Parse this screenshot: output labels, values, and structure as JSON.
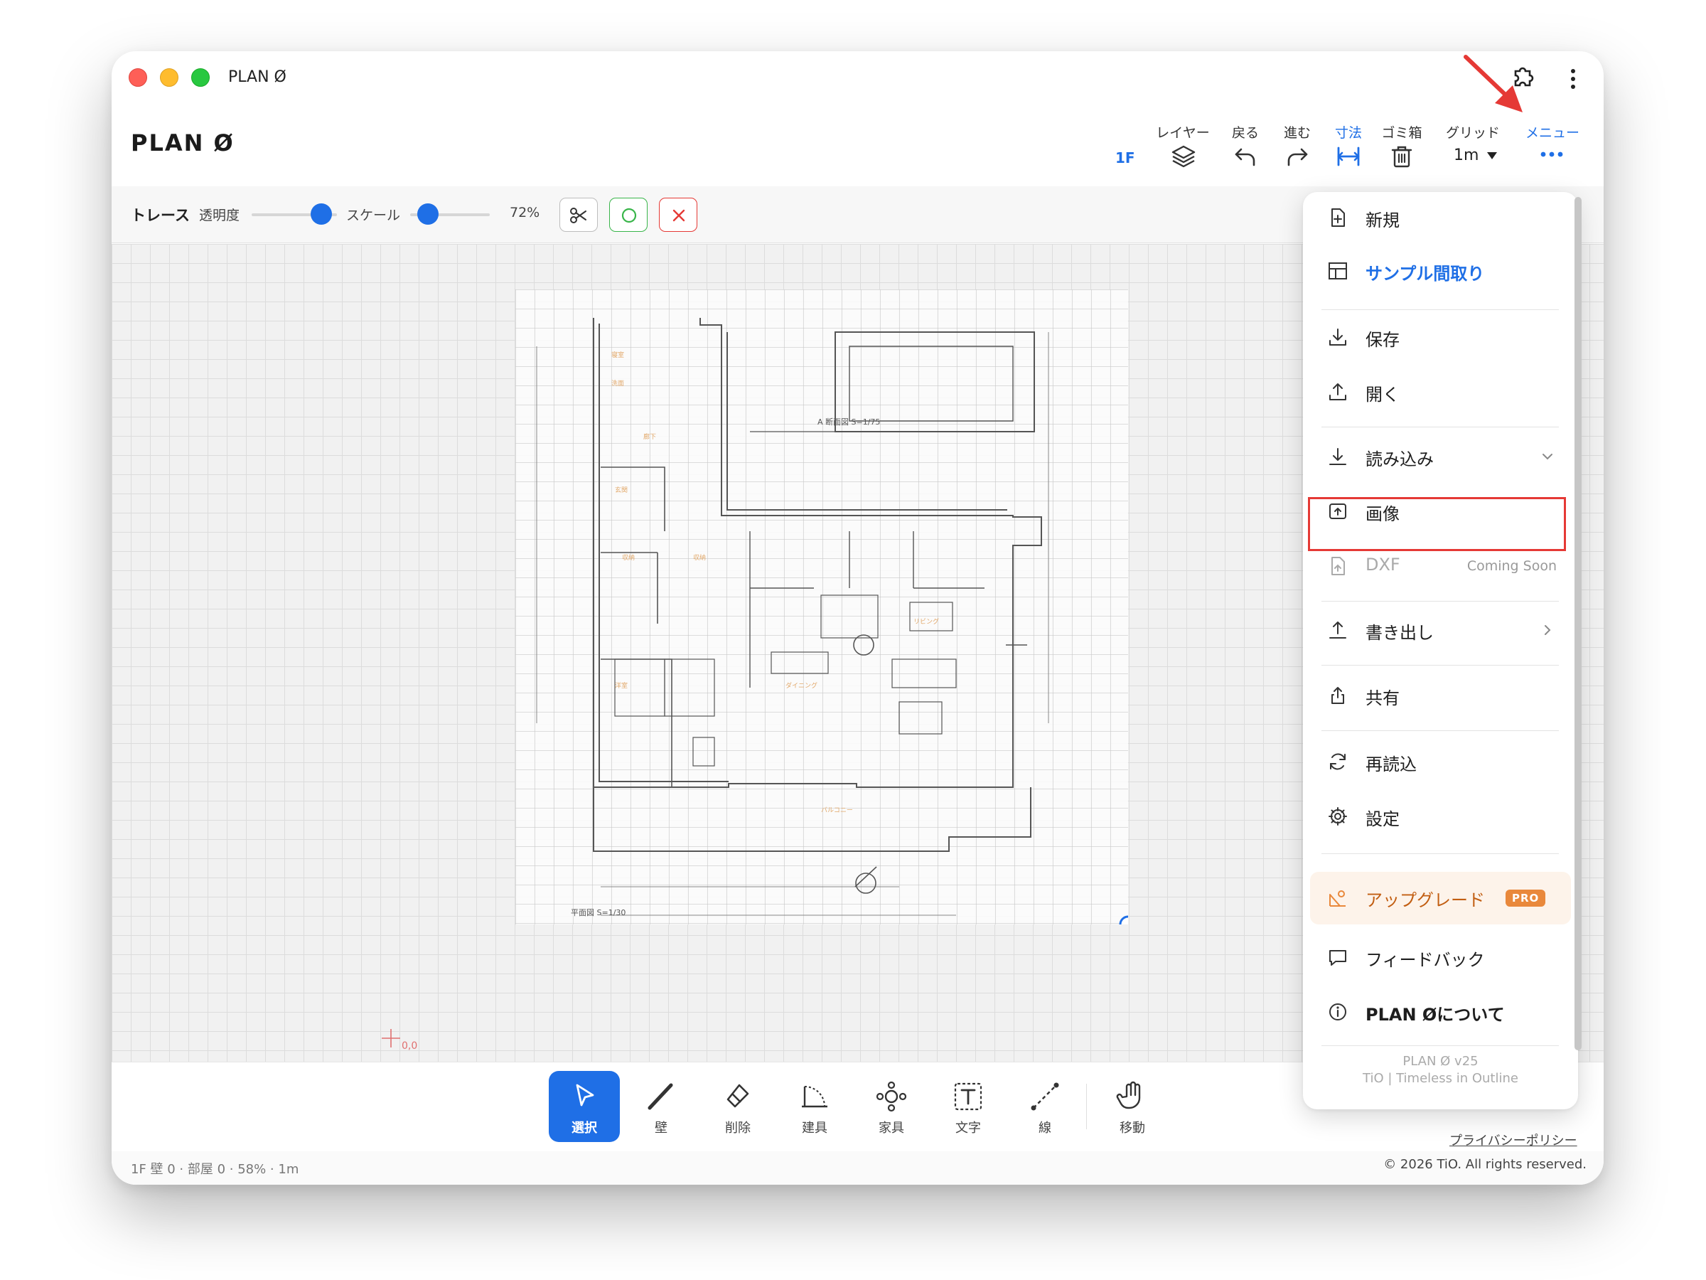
{
  "window": {
    "title": "PLAN Ø"
  },
  "header": {
    "app_title": "PLAN Ø",
    "floor": "1F",
    "tools": [
      {
        "label": "レイヤー",
        "icon": "layers-icon"
      },
      {
        "label": "戻る",
        "icon": "undo-icon"
      },
      {
        "label": "進む",
        "icon": "redo-icon"
      },
      {
        "label": "寸法",
        "icon": "dimension-icon",
        "active": true
      },
      {
        "label": "ゴミ箱",
        "icon": "trash-icon"
      },
      {
        "label": "グリッド",
        "icon": "grid-select"
      },
      {
        "label": "メニュー",
        "icon": "more-icon",
        "active": true
      }
    ],
    "grid_value": "1m"
  },
  "trace": {
    "title": "トレース",
    "opacity_label": "透明度",
    "opacity_value": 0.8,
    "scale_label": "スケール",
    "scale_value": 0.25,
    "scale_percent": "72%"
  },
  "canvas": {
    "origin_label": "0,0",
    "plan_caption": "平面図 S=1/30",
    "section_caption": "A 断面図 S=1/75"
  },
  "bottom_tools": [
    {
      "label": "選択",
      "icon": "select-cursor-icon",
      "active": true
    },
    {
      "label": "壁",
      "icon": "wall-pen-icon"
    },
    {
      "label": "削除",
      "icon": "eraser-icon"
    },
    {
      "label": "建具",
      "icon": "door-icon"
    },
    {
      "label": "家具",
      "icon": "furniture-icon"
    },
    {
      "label": "文字",
      "icon": "text-icon"
    },
    {
      "label": "線",
      "icon": "line-icon"
    },
    {
      "label": "移動",
      "icon": "hand-icon"
    }
  ],
  "footer": {
    "status": "1F 壁 0 · 部屋 0 · 58% · 1m",
    "privacy": "プライバシーポリシー",
    "copyright": "© 2026 TiO. All rights reserved."
  },
  "menu": {
    "items": [
      {
        "label": "新規",
        "icon": "new-file-icon"
      },
      {
        "label": "サンプル間取り",
        "icon": "floorplan-icon"
      },
      {
        "label": "保存",
        "icon": "download-icon"
      },
      {
        "label": "開く",
        "icon": "upload-icon"
      },
      {
        "label": "読み込み",
        "icon": "import-icon"
      },
      {
        "label": "画像",
        "icon": "image-upload-icon"
      },
      {
        "label": "DXF",
        "icon": "dxf-file-icon",
        "sub": "Coming Soon"
      },
      {
        "label": "書き出し",
        "icon": "export-icon"
      },
      {
        "label": "共有",
        "icon": "share-icon"
      },
      {
        "label": "再読込",
        "icon": "reload-icon"
      },
      {
        "label": "設定",
        "icon": "gear-icon"
      },
      {
        "label": "アップグレード",
        "icon": "upgrade-icon",
        "badge": "PRO"
      },
      {
        "label": "フィードバック",
        "icon": "feedback-icon"
      },
      {
        "label": "PLAN Øについて",
        "icon": "info-icon"
      }
    ],
    "version": "PLAN Ø v25",
    "tagline": "TiO | Timeless in Outline"
  },
  "colors": {
    "accent": "#1f6fe6",
    "highlight": "#e53935",
    "upgrade": "#e9883b"
  }
}
